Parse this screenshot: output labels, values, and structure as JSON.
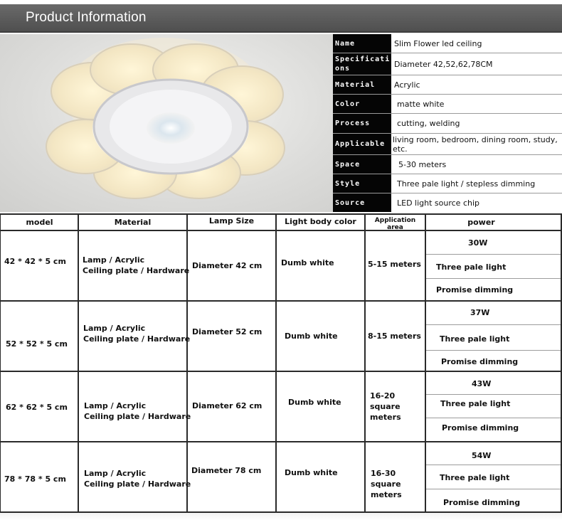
{
  "header": {
    "title": "Product Information"
  },
  "spec": [
    {
      "key": "Name",
      "value": "Slim Flower led ceiling"
    },
    {
      "key": "Specifications",
      "value": "Diameter 42,52,62,78CM"
    },
    {
      "key": "Material",
      "value": "Acrylic"
    },
    {
      "key": "Color",
      "value": "matte white"
    },
    {
      "key": "Process",
      "value": "cutting, welding"
    },
    {
      "key": "Applicable",
      "value": "living room, bedroom, dining room, study, etc."
    },
    {
      "key": "Space",
      "value": "5-30 meters"
    },
    {
      "key": "Style",
      "value": "Three pale light / stepless dimming"
    },
    {
      "key": "Source",
      "value": "LED light source chip"
    }
  ],
  "table": {
    "headers": [
      "model",
      "Material",
      "Lamp Size",
      "Light body color",
      "Application area",
      "power"
    ],
    "rows": [
      {
        "model": "42 * 42 * 5 cm",
        "material_1": "Lamp / Acrylic",
        "material_2": "Ceiling plate / Hardware",
        "size": "Diameter 42 cm",
        "color": "Dumb white",
        "area": "5-15 meters",
        "power": "30W",
        "light": "Three pale light",
        "dimming": "Promise dimming"
      },
      {
        "model": "52 * 52 * 5 cm",
        "material_1": "Lamp / Acrylic",
        "material_2": "Ceiling plate / Hardware",
        "size": "Diameter 52 cm",
        "color": "Dumb white",
        "area": "8-15 meters",
        "power": "37W",
        "light": "Three pale light",
        "dimming": "Promise dimming"
      },
      {
        "model": "62 * 62 * 5 cm",
        "material_1": "Lamp / Acrylic",
        "material_2": "Ceiling plate / Hardware",
        "size": "Diameter 62 cm",
        "color": "Dumb white",
        "area": "16-20 square meters",
        "power": "43W",
        "light": "Three pale light",
        "dimming": "Promise dimming"
      },
      {
        "model": "78 * 78 * 5 cm",
        "material_1": "Lamp / Acrylic",
        "material_2": "Ceiling plate / Hardware",
        "size": "Diameter 78 cm",
        "color": "Dumb white",
        "area": "16-30 square meters",
        "power": "54W",
        "light": "Three pale light",
        "dimming": "Promise dimming"
      }
    ]
  }
}
